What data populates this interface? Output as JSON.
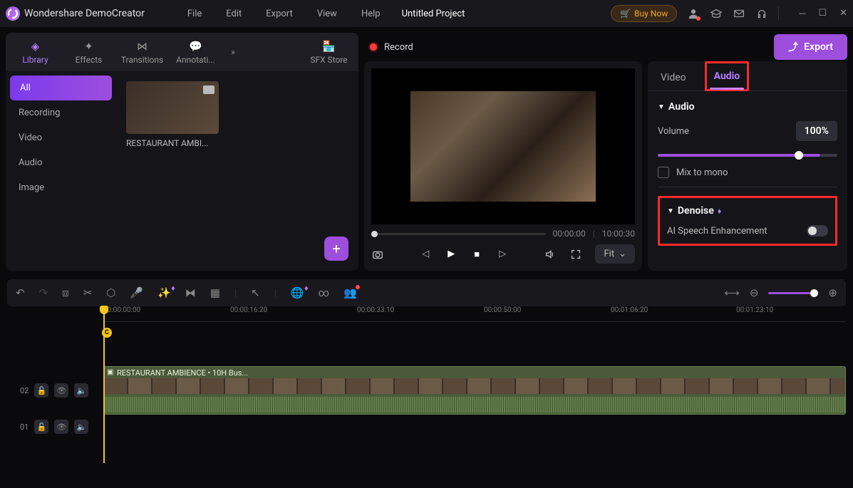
{
  "titlebar": {
    "app_name": "Wondershare DemoCreator",
    "menus": [
      "File",
      "Edit",
      "Export",
      "View",
      "Help"
    ],
    "project_title": "Untitled Project",
    "buy_label": "Buy Now"
  },
  "tool_tabs": [
    "Library",
    "Effects",
    "Transitions",
    "Annotati...",
    "SFX Store"
  ],
  "categories": [
    "All",
    "Recording",
    "Video",
    "Audio",
    "Image"
  ],
  "media": {
    "item0_name": "RESTAURANT AMBI..."
  },
  "record": {
    "label": "Record",
    "export_label": "Export"
  },
  "preview": {
    "current_time": "00:00:00",
    "total_time": "10:00:30",
    "fit_label": "Fit"
  },
  "props": {
    "tab_video": "Video",
    "tab_audio": "Audio",
    "section_audio": "Audio",
    "volume_label": "Volume",
    "volume_value": "100%",
    "mix_label": "Mix to mono",
    "section_denoise": "Denoise",
    "ai_label": "AI Speech Enhancement"
  },
  "timeline": {
    "ticks": [
      "00:00:00:00",
      "00:00:16:20",
      "00:00:33:10",
      "00:00:50:00",
      "00:01:06:20",
      "00:01:23:10"
    ],
    "marker": "C",
    "track02": "02",
    "track01": "01",
    "clip_label": "RESTAURANT AMBIENCE • 10H Bus..."
  }
}
